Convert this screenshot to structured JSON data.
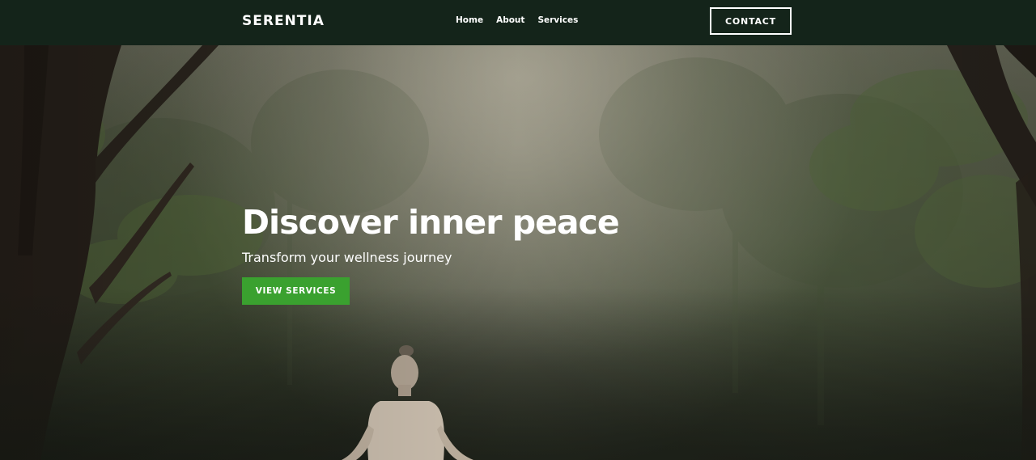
{
  "header": {
    "brand": "SERENTIA",
    "nav": [
      {
        "label": "Home"
      },
      {
        "label": "About"
      },
      {
        "label": "Services"
      }
    ],
    "contact_label": "CONTACT"
  },
  "hero": {
    "title": "Discover inner peace",
    "subtitle": "Transform your wellness journey",
    "cta_label": "VIEW SERVICES",
    "background_image": "misty-forest-meditation-image"
  },
  "colors": {
    "navbar_bg": "#14241a",
    "accent_green": "#3aa12f",
    "text": "#ffffff"
  }
}
